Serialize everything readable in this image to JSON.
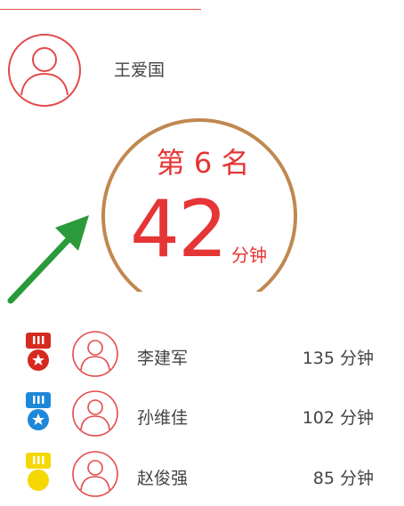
{
  "user": {
    "name": "王爱国"
  },
  "rank": {
    "label": "第 6 名",
    "minutes": "42",
    "unit": "分钟"
  },
  "leaderboard": [
    {
      "name": "李建军",
      "minutes": "135 分钟",
      "medal_color": "#d62a1e"
    },
    {
      "name": "孙维佳",
      "minutes": "102 分钟",
      "medal_color": "#1e88d8"
    },
    {
      "name": "赵俊强",
      "minutes": "85 分钟",
      "medal_color": "#f5d800"
    }
  ],
  "colors": {
    "accent": "#e53535",
    "ring": "#c08850",
    "arrow": "#2a9a3a"
  }
}
